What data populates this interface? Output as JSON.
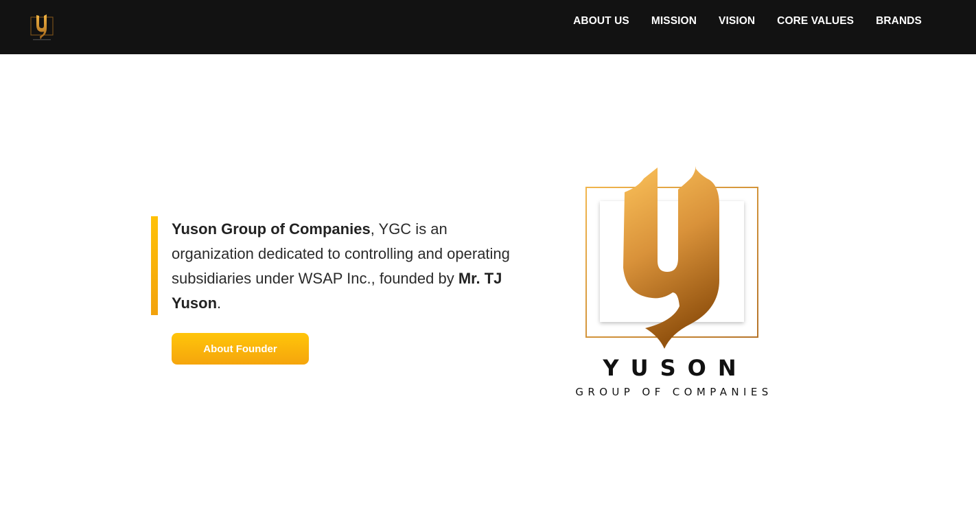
{
  "header": {
    "logo_icon": "yuson-y-logo-icon",
    "nav": [
      {
        "label": "ABOUT US"
      },
      {
        "label": "MISSION"
      },
      {
        "label": "VISION"
      },
      {
        "label": "CORE VALUES"
      },
      {
        "label": "BRANDS"
      }
    ]
  },
  "intro": {
    "company_name": "Yuson Group of Companies",
    "text_part1": ", YGC is an organization dedicated to controlling and operating subsidiaries under WSAP Inc., founded by ",
    "founder_name": "Mr. TJ Yuson",
    "text_part2": "."
  },
  "buttons": {
    "about_founder": "About Founder"
  },
  "brand_logo": {
    "name": "YUSON",
    "subtitle": "GROUP OF COMPANIES"
  },
  "colors": {
    "nav_background": "#121212",
    "accent_gold": "#f5b00a",
    "logo_gold_light": "#f6b94a",
    "logo_gold_dark": "#9a5a14"
  }
}
